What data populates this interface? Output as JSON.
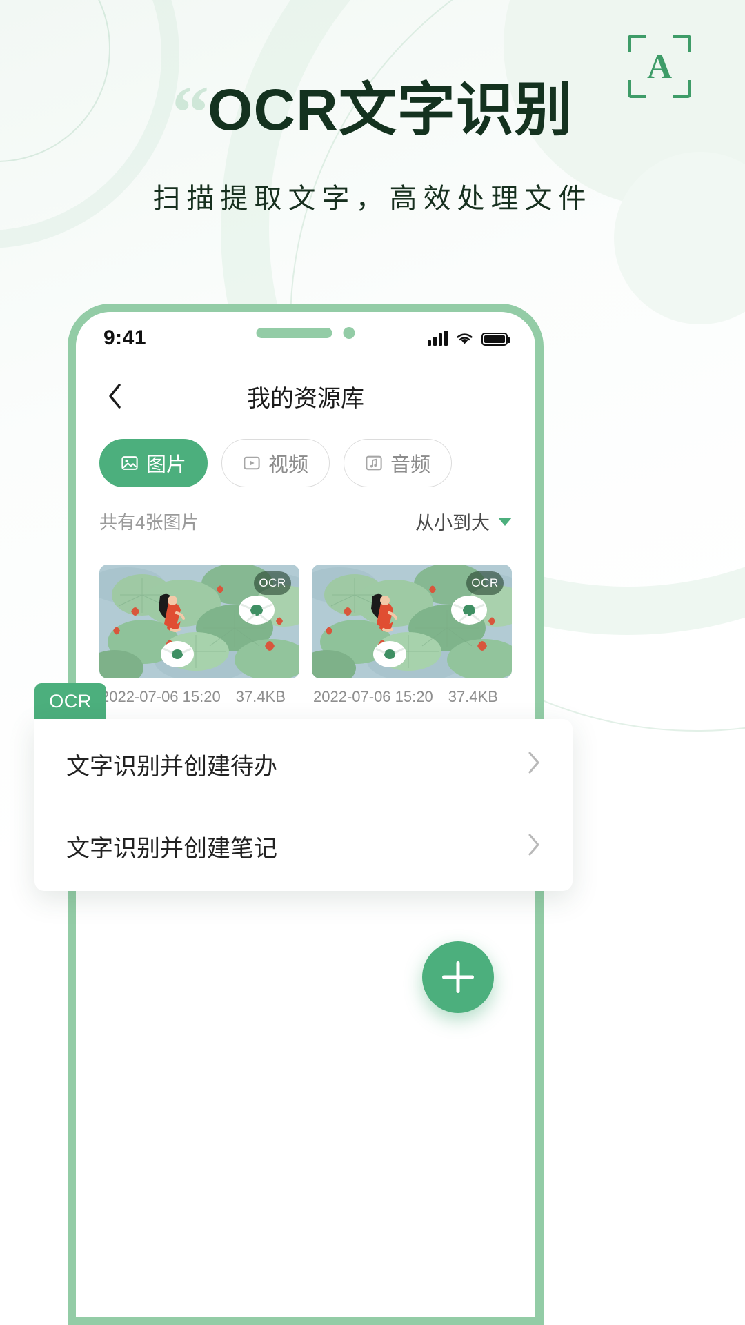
{
  "header": {
    "quote_mark": "“",
    "title": "OCR文字识别",
    "subtitle": "扫描提取文字，高效处理文件",
    "scan_icon_letter": "A",
    "accent_color": "#4caf7d",
    "title_color": "#14321f",
    "frame_color": "#93cca6"
  },
  "phone": {
    "status_bar": {
      "time": "9:41"
    },
    "nav": {
      "title": "我的资源库",
      "back_label": "返回"
    },
    "filter_chips": [
      {
        "label": "图片",
        "icon": "image-icon",
        "active": true
      },
      {
        "label": "视频",
        "icon": "video-icon",
        "active": false
      },
      {
        "label": "音频",
        "icon": "audio-icon",
        "active": false
      }
    ],
    "meta": {
      "count_text": "共有4张图片",
      "sort_label": "从小到大"
    },
    "items": [
      {
        "badge": "OCR",
        "date": "2022-07-06 15:20",
        "size": "37.4KB"
      },
      {
        "badge": "OCR",
        "date": "2022-07-06 15:20",
        "size": "37.4KB"
      }
    ],
    "popup": {
      "tab_label": "OCR",
      "rows": [
        {
          "label": "文字识别并创建待办"
        },
        {
          "label": "文字识别并创建笔记"
        }
      ]
    },
    "fab": {
      "label": "+"
    }
  }
}
